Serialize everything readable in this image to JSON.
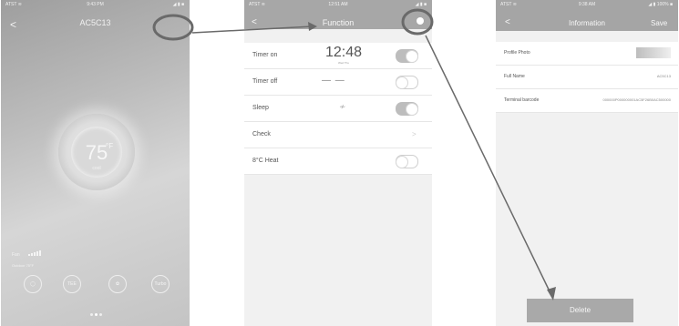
{
  "phone1": {
    "status": {
      "left": "ATST ≋",
      "center": "9:43 PM",
      "right": "◢ ▮ ■"
    },
    "back": "<",
    "title": "AC5C13",
    "temperature": "75",
    "unit": "°F",
    "mode": "cool",
    "fan_label": "Fan",
    "outdoor_label": "Outdoor 75°F",
    "controls": [
      "◯",
      "TEE",
      "✿",
      "Turbo"
    ]
  },
  "phone2": {
    "status": {
      "left": "ATST ≋",
      "center": "12:51 AM",
      "right": "◢ ▮ ■"
    },
    "back": "<",
    "title": "Function",
    "rows": [
      {
        "label": "Timer on",
        "time": "12:48",
        "sub": "Wed Thu",
        "toggle": "on"
      },
      {
        "label": "Timer off",
        "value": "— —",
        "toggle": "off"
      },
      {
        "label": "Sleep",
        "value": "≁",
        "toggle": "on"
      },
      {
        "label": "Check",
        "chevron": ">"
      },
      {
        "label": "8°C Heat",
        "toggle": "off"
      }
    ]
  },
  "phone3": {
    "status": {
      "left": "ATST ≋",
      "center": "9:38 AM",
      "right": "◢ ▮ 100% ■"
    },
    "back": "<",
    "title": "Information",
    "save": "Save",
    "rows": [
      {
        "label": "Profile Photo"
      },
      {
        "label": "Full Name",
        "value": "AC5C13"
      },
      {
        "label": "Terminal barcode",
        "value": "000000P000000001AC5F26B0AC500000"
      }
    ],
    "delete": "Delete"
  }
}
